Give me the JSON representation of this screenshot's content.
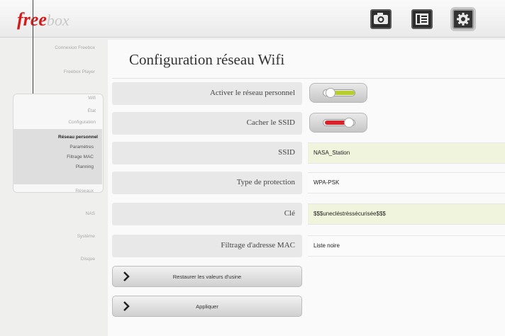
{
  "header": {
    "logo_main": "free",
    "logo_sub": "box",
    "icons": [
      "camera-icon",
      "film-icon",
      "gear-icon"
    ]
  },
  "sidebar": {
    "top_items": [
      "Connexion Freebox",
      "Freebox Player"
    ],
    "group_items": [
      "Wifi",
      "État",
      "Configuration"
    ],
    "sub_items": [
      "Réseau personnel",
      "Paramètres",
      "Filtrage MAC",
      "Planning",
      "Réseaux"
    ],
    "bottom_items": [
      "NAS",
      "Système",
      "Disque"
    ]
  },
  "page": {
    "title": "Configuration réseau Wifi",
    "rows": [
      {
        "label": "Activer le réseau personnel",
        "type": "toggle",
        "state": "on",
        "color": "#b7cc2e"
      },
      {
        "label": "Cacher le SSID",
        "type": "toggle",
        "state": "off",
        "color": "#d9232a"
      },
      {
        "label": "SSID",
        "type": "text",
        "value": "NASA_Station"
      },
      {
        "label": "Type de protection",
        "type": "select",
        "value": "WPA-PSK"
      },
      {
        "label": "Clé",
        "type": "text",
        "value": "$$$unecléstrèssécurisée$$$"
      },
      {
        "label": "Filtrage d'adresse MAC",
        "type": "select",
        "value": "Liste noire"
      }
    ],
    "buttons": {
      "restore": "Restaurer les valeurs d'usine",
      "apply": "Appliquer"
    }
  },
  "colors": {
    "brand_red": "#d41b1b",
    "toggle_on": "#b7cc2e",
    "toggle_off": "#d9232a",
    "field_highlight": "#f1f4dc"
  }
}
